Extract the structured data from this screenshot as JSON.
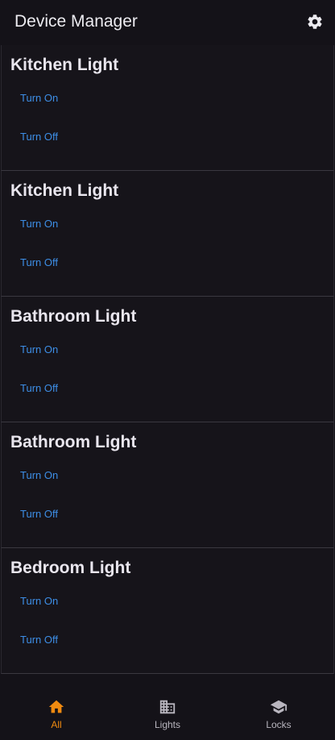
{
  "header": {
    "title": "Device Manager",
    "settings_icon": "gear-icon"
  },
  "devices": [
    {
      "name": "Kitchen Light",
      "on_label": "Turn On",
      "off_label": "Turn Off"
    },
    {
      "name": "Kitchen Light",
      "on_label": "Turn On",
      "off_label": "Turn Off"
    },
    {
      "name": "Bathroom Light",
      "on_label": "Turn On",
      "off_label": "Turn Off"
    },
    {
      "name": "Bathroom Light",
      "on_label": "Turn On",
      "off_label": "Turn Off"
    },
    {
      "name": "Bedroom Light",
      "on_label": "Turn On",
      "off_label": "Turn Off"
    }
  ],
  "bottom_nav": {
    "items": [
      {
        "label": "All",
        "icon": "home-icon",
        "active": true
      },
      {
        "label": "Lights",
        "icon": "building-icon",
        "active": false
      },
      {
        "label": "Locks",
        "icon": "school-icon",
        "active": false
      }
    ]
  },
  "colors": {
    "background": "#141218",
    "accent": "#f08a10",
    "link": "#3d8ee6",
    "text": "#e9e6ee"
  }
}
